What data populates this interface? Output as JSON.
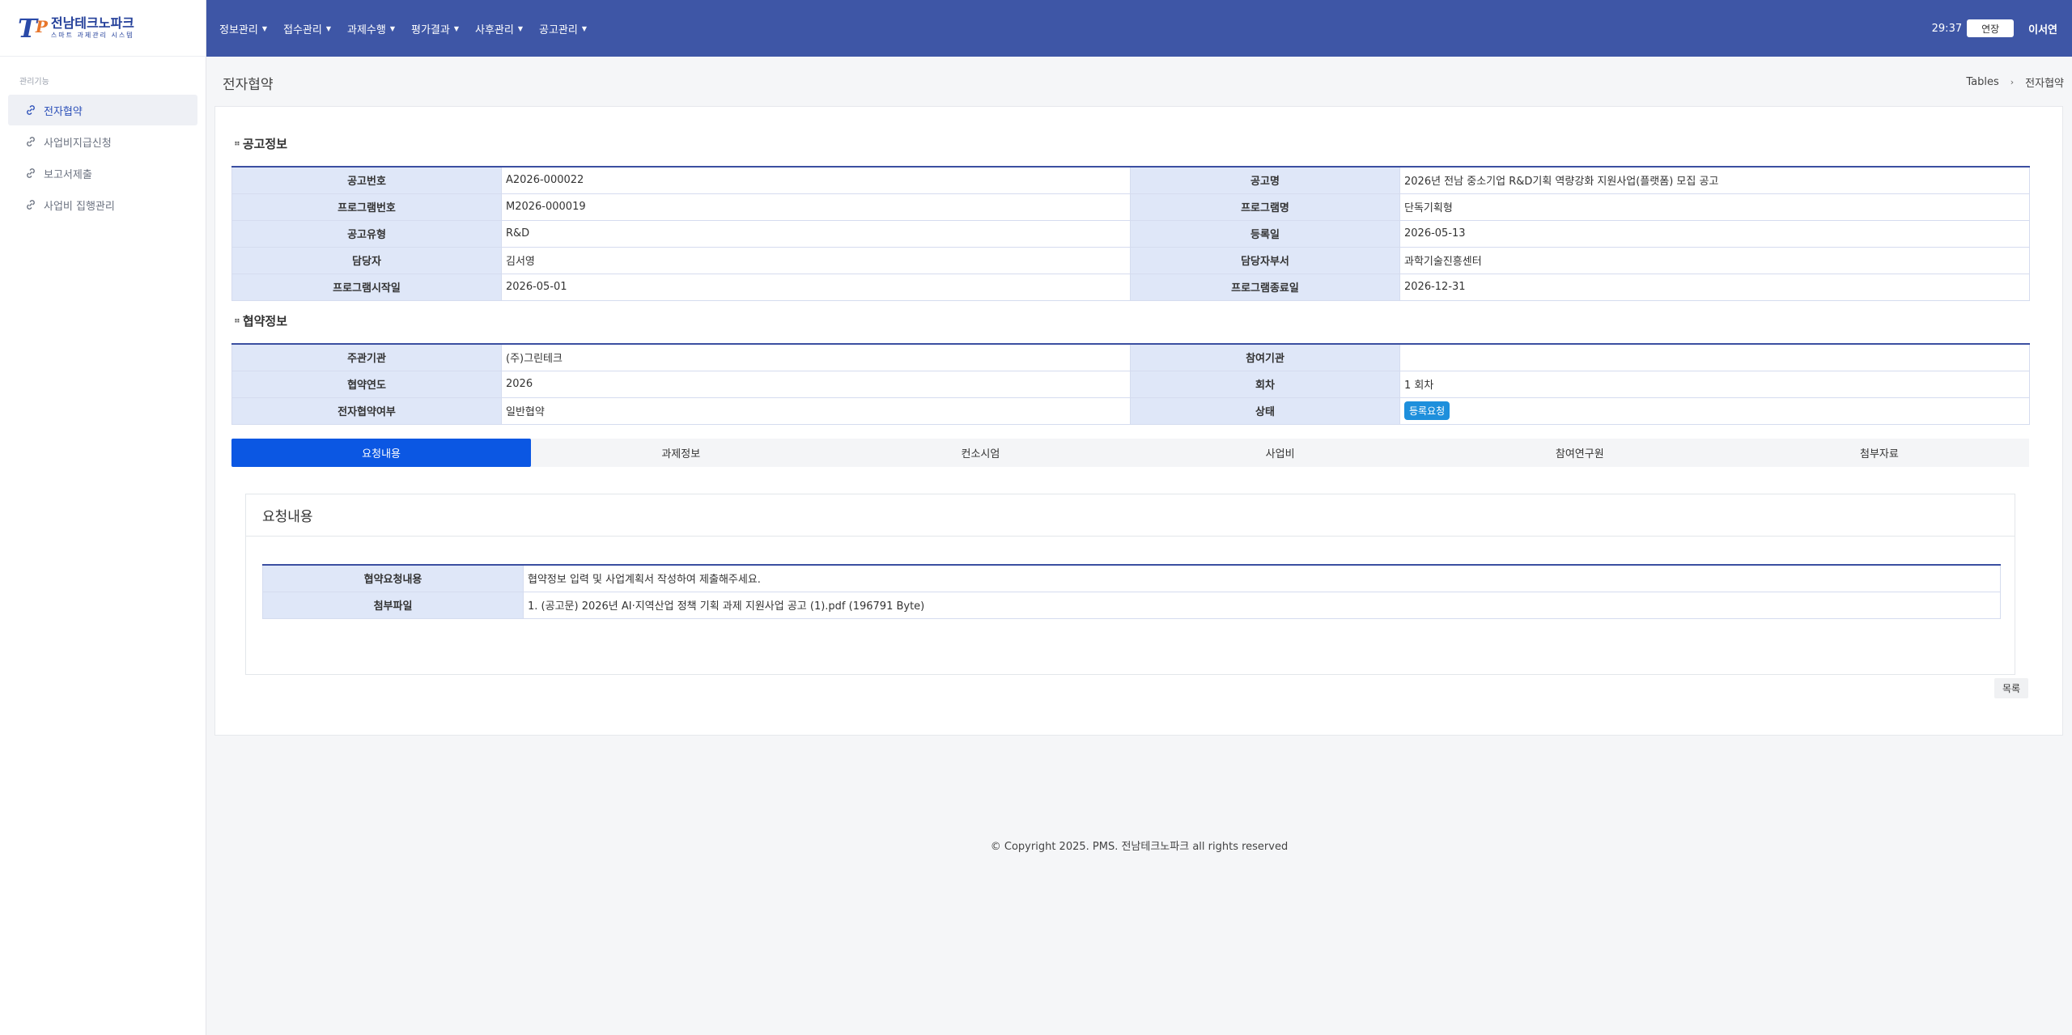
{
  "logo": {
    "mark": "TP",
    "title": "전남테크노파크",
    "subtitle": "스마트 과제관리 시스템"
  },
  "sidebar": {
    "section": "관리기능",
    "items": [
      {
        "label": "전자협약",
        "active": true
      },
      {
        "label": "사업비지급신청",
        "active": false
      },
      {
        "label": "보고서제출",
        "active": false
      },
      {
        "label": "사업비 집행관리",
        "active": false
      }
    ]
  },
  "topnav": {
    "menu": [
      "정보관리",
      "접수관리",
      "과제수행",
      "평가결과",
      "사후관리",
      "공고관리"
    ],
    "timer": "29:37",
    "extend_label": "연장",
    "user": "이서연"
  },
  "page": {
    "title": "전자협약",
    "breadcrumb": [
      "Tables",
      "전자협약"
    ]
  },
  "notice_section": {
    "title": "공고정보",
    "rows": [
      {
        "l1": "공고번호",
        "v1": "A2026-000022",
        "l2": "공고명",
        "v2": "2026년 전남 중소기업 R&D기획 역량강화 지원사업(플랫폼) 모집 공고"
      },
      {
        "l1": "프로그램번호",
        "v1": "M2026-000019",
        "l2": "프로그램명",
        "v2": "단독기획형"
      },
      {
        "l1": "공고유형",
        "v1": "R&D",
        "l2": "등록일",
        "v2": "2026-05-13"
      },
      {
        "l1": "담당자",
        "v1": "김서영",
        "l2": "담당자부서",
        "v2": "과학기술진흥센터"
      },
      {
        "l1": "프로그램시작일",
        "v1": "2026-05-01",
        "l2": "프로그램종료일",
        "v2": "2026-12-31"
      }
    ]
  },
  "agreement_section": {
    "title": "협약정보",
    "rows": [
      {
        "l1": "주관기관",
        "v1": "(주)그린테크",
        "l2": "참여기관",
        "v2": ""
      },
      {
        "l1": "협약연도",
        "v1": "2026",
        "l2": "회차",
        "v2": "1 회차"
      },
      {
        "l1": "전자협약여부",
        "v1": "일반협약",
        "l2": "상태",
        "v2": "등록요청"
      }
    ],
    "status_color": "#1e8fdc"
  },
  "tabs": [
    "요청내용",
    "과제정보",
    "컨소시엄",
    "사업비",
    "참여연구원",
    "첨부자료"
  ],
  "active_tab": 0,
  "request": {
    "title": "요청내용",
    "rows": [
      {
        "label": "협약요청내용",
        "value": "협약정보 입력 및 사업계획서 작성하여 제출해주세요."
      },
      {
        "label": "첨부파일",
        "value": "1. (공고문) 2026년 AI·지역산업 정책 기획 과제 지원사업 공고 (1).pdf (196791 Byte)"
      }
    ]
  },
  "list_button": "목록",
  "footer": "© Copyright 2025. PMS. 전남테크노파크 all rights reserved",
  "colors": {
    "topbar": "#3e56a6",
    "active_tab": "#0b57e3",
    "label_bg": "#dfe7f8"
  }
}
